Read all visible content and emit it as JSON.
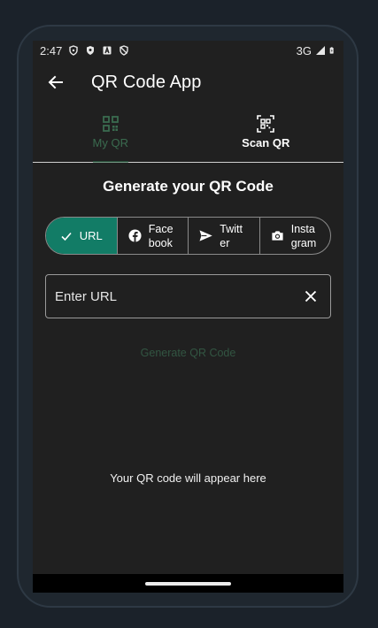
{
  "status_bar": {
    "time": "2:47",
    "network": "3G",
    "icons": [
      "shield-outline-icon",
      "shield-filled-icon",
      "a-badge-icon",
      "shield-slash-icon",
      "signal-icon",
      "battery-charging-icon"
    ]
  },
  "app_bar": {
    "title": "QR Code App",
    "back_icon": "arrow-back-icon"
  },
  "tabs": [
    {
      "label": "My QR",
      "icon": "qr-code-icon",
      "active": false
    },
    {
      "label": "Scan QR",
      "icon": "qr-scan-icon",
      "active": true
    }
  ],
  "heading": "Generate your QR Code",
  "segments": [
    {
      "label": "URL",
      "icon": "check-icon",
      "selected": true
    },
    {
      "label": "Face book",
      "icon": "facebook-icon",
      "selected": false
    },
    {
      "label": "Twitt er",
      "icon": "send-icon",
      "selected": false
    },
    {
      "label": "Insta gram",
      "icon": "camera-icon",
      "selected": false
    }
  ],
  "url_input": {
    "placeholder": "Enter URL",
    "value": ""
  },
  "generate_button": "Generate QR Code",
  "placeholder_message": "Your QR code will appear here",
  "colors": {
    "accent": "#127c66",
    "background": "#202020",
    "frame": "#1b222a"
  }
}
